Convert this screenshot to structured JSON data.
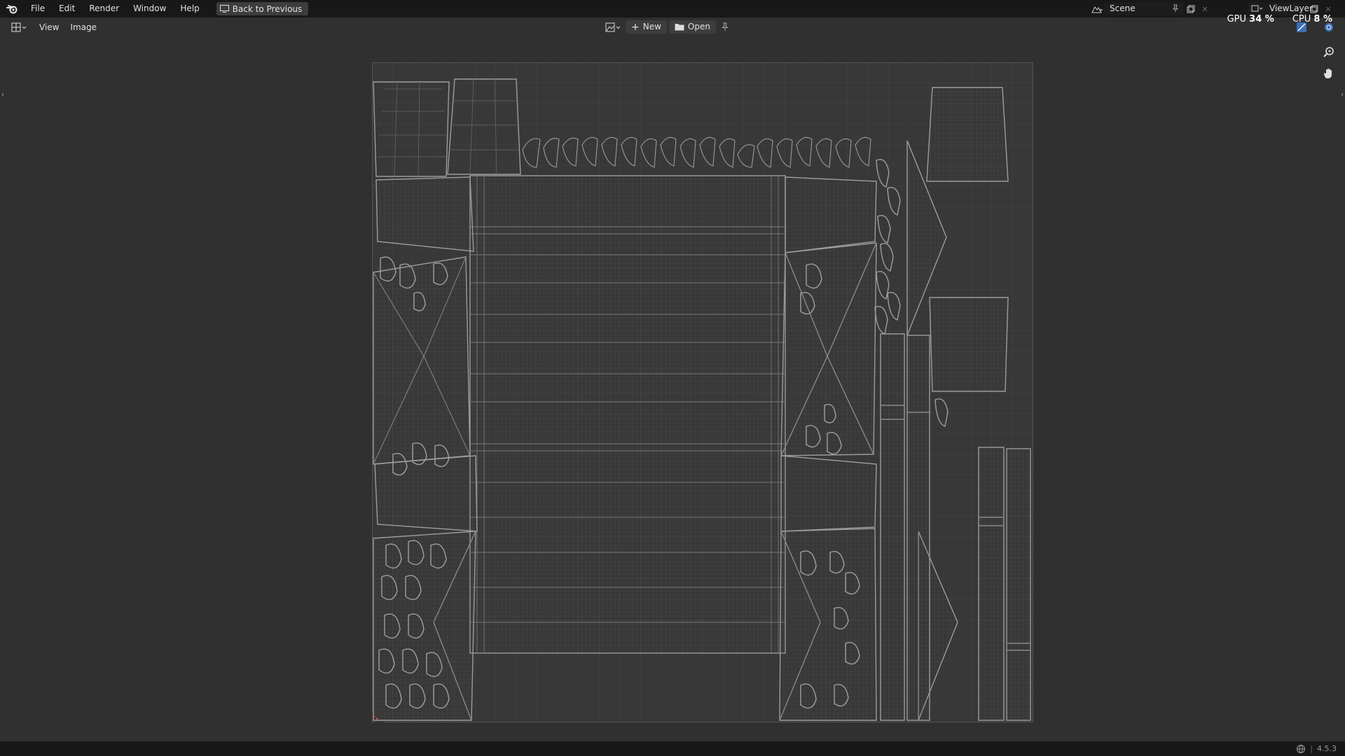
{
  "topbar": {
    "menus": [
      "File",
      "Edit",
      "Render",
      "Window",
      "Help"
    ],
    "back_button": "Back to Previous",
    "scene": "Scene",
    "view_layer": "ViewLayer"
  },
  "stats": {
    "gpu_label": "GPU",
    "gpu_value": "34 %",
    "cpu_label": "CPU",
    "cpu_value": "8 %"
  },
  "header": {
    "menus": [
      "View",
      "Image"
    ],
    "new_label": "New",
    "open_label": "Open"
  },
  "status": {
    "version": "4.5.3"
  },
  "colors": {
    "bg": "#303030",
    "topbar": "#181818",
    "canvas": "#3a3a3a",
    "wire": "#9a9a9a",
    "grid": "#464646"
  }
}
